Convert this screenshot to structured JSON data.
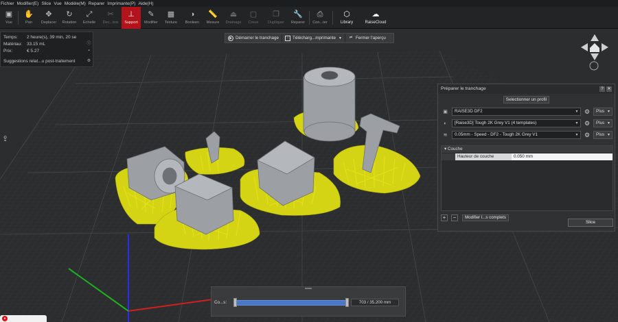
{
  "menu": [
    "Fichier",
    "Modifier(E)",
    "Slice",
    "Vue",
    "Modèle(M)",
    "Reparer",
    "Imprimante(P)",
    "Aide(H)"
  ],
  "toolbar": {
    "vue": "Vue",
    "pan": "Pan",
    "deplacer": "Deplacer",
    "rotation": "Rotation",
    "echelle": "Echelle",
    "decoupe": "Dec...bre",
    "support": "Support",
    "modifier": "Modifier",
    "texture": "Texture",
    "booleen": "Booleen",
    "mesure": "Mesure",
    "drainage": "Drainage",
    "creux": "Creux",
    "dupliquer": "Dupliquer",
    "reparer": "Reparer",
    "connecter": "Con...ter",
    "library": "Library",
    "raisecloud": "RaiseCloud"
  },
  "info": {
    "temps_label": "Temps:",
    "temps_value": "2 heure(s), 39 min, 20 se",
    "materiau_label": "Matériau:",
    "materiau_value": "33.15 mL",
    "prix_label": "Prix:",
    "prix_value": "€ 5.27",
    "suggestions": "Suggestions relat...u post-traitement"
  },
  "actions": {
    "start": "Démarrer le tranchage",
    "upload": "Télécharg...mprimante",
    "close": "Fermer l'aperçu"
  },
  "panel": {
    "title": "Préparer le tranchage",
    "select_profile": "Selectionner un profil",
    "printer": "RAISE3D DF2",
    "material": "[Raise3D] Tough 2K Grey V1 (4 templates)",
    "profile": "0.05mm - Speed - DF2 - Tough 2K Grey V1",
    "plus": "Plus",
    "group": "Couche",
    "param_label": "Hauteur de couche",
    "param_value": "0.050 mm",
    "modify": "Modifier l...s complets",
    "slice": "Slice"
  },
  "layer": {
    "label": "Co...s:",
    "value": "703 / 35.200 mm"
  },
  "colors": {
    "support": "#d4d414",
    "model": "#9c9fa3",
    "active_tool": "#b3141c",
    "slider": "#4a78c9"
  }
}
